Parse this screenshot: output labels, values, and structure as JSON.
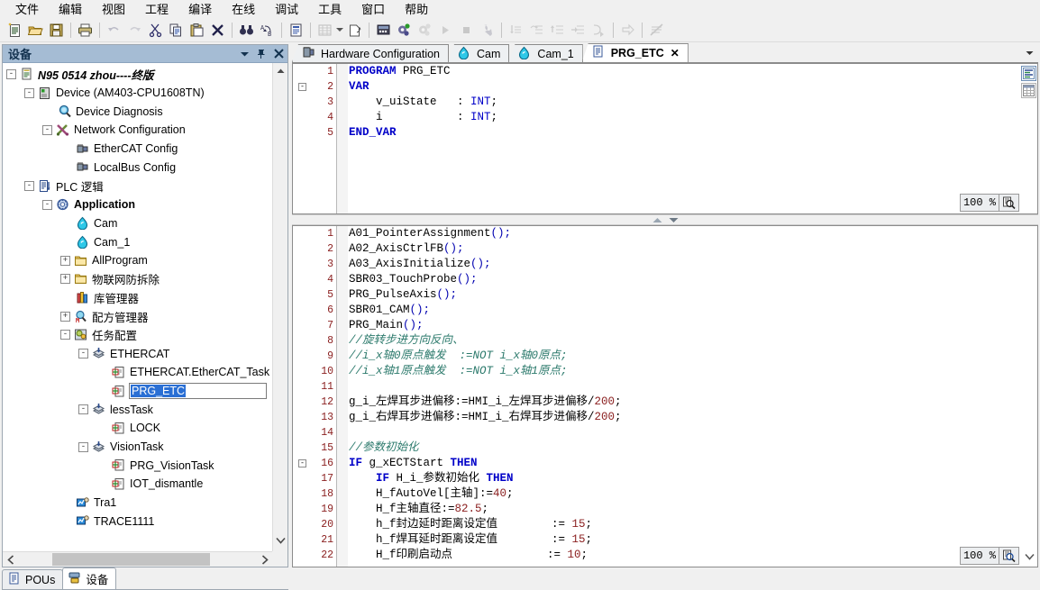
{
  "menu": {
    "items": [
      {
        "label": "文件",
        "name": "menu-file"
      },
      {
        "label": "编辑",
        "name": "menu-edit"
      },
      {
        "label": "视图",
        "name": "menu-view"
      },
      {
        "label": "工程",
        "name": "menu-project"
      },
      {
        "label": "编译",
        "name": "menu-build"
      },
      {
        "label": "在线",
        "name": "menu-online"
      },
      {
        "label": "调试",
        "name": "menu-debug"
      },
      {
        "label": "工具",
        "name": "menu-tools"
      },
      {
        "label": "窗口",
        "name": "menu-window"
      },
      {
        "label": "帮助",
        "name": "menu-help"
      }
    ]
  },
  "toolbar": {
    "buttons": [
      {
        "icon": "new-file-icon",
        "enabled": true
      },
      {
        "icon": "open-folder-icon",
        "enabled": true
      },
      {
        "icon": "save-icon",
        "enabled": true
      },
      {
        "sep": true
      },
      {
        "icon": "print-icon",
        "enabled": true
      },
      {
        "sep": true
      },
      {
        "icon": "undo-icon",
        "enabled": false
      },
      {
        "icon": "redo-icon",
        "enabled": false
      },
      {
        "icon": "cut-scissors-icon",
        "enabled": true
      },
      {
        "icon": "copy-icon",
        "enabled": true
      },
      {
        "icon": "paste-icon",
        "enabled": true
      },
      {
        "icon": "delete-x-icon",
        "enabled": true
      },
      {
        "sep": true
      },
      {
        "icon": "find-binoculars-icon",
        "enabled": true
      },
      {
        "icon": "replace-ab-icon",
        "enabled": true
      },
      {
        "sep": true
      },
      {
        "icon": "paste-clipboard-icon",
        "enabled": true
      },
      {
        "sep": true
      },
      {
        "icon": "grid-table-icon",
        "enabled": false,
        "dropdown": true
      },
      {
        "icon": "export-page-icon",
        "enabled": true
      },
      {
        "sep": true
      },
      {
        "icon": "login-plc-icon",
        "enabled": true
      },
      {
        "icon": "build-gears-green-icon",
        "enabled": true
      },
      {
        "icon": "build-gears-grey-icon",
        "enabled": false
      },
      {
        "icon": "run-play-icon",
        "enabled": false
      },
      {
        "icon": "stop-square-icon",
        "enabled": false
      },
      {
        "icon": "wrench-icon",
        "enabled": false
      },
      {
        "sep": true
      },
      {
        "icon": "step-into-icon",
        "enabled": false
      },
      {
        "icon": "step-over-icon",
        "enabled": false
      },
      {
        "icon": "step-out-icon",
        "enabled": false
      },
      {
        "icon": "run-to-cursor-icon",
        "enabled": false
      },
      {
        "icon": "set-next-statement-icon",
        "enabled": false
      },
      {
        "sep": true
      },
      {
        "icon": "next-arrow-icon",
        "enabled": false
      },
      {
        "sep": true
      },
      {
        "icon": "breakpoints-off-icon",
        "enabled": false
      }
    ]
  },
  "devices_panel": {
    "title": "设备",
    "header_buttons": [
      {
        "name": "panel-menu-dropdown-icon",
        "glyph": "▼"
      },
      {
        "name": "pin-icon",
        "glyph": "pin"
      },
      {
        "name": "close-icon",
        "glyph": "✕"
      }
    ],
    "tree": [
      {
        "indent": 0,
        "expander": "-",
        "icon": "project-doc-icon",
        "label": "N95 0514 zhou----终版",
        "style": "italic"
      },
      {
        "indent": 1,
        "expander": "-",
        "icon": "plc-device-icon",
        "label": "Device (AM403-CPU1608TN)",
        "style": "normal"
      },
      {
        "indent": 2,
        "expander": "",
        "icon": "diagnosis-magnifier-icon",
        "label": "Device Diagnosis",
        "style": "normal"
      },
      {
        "indent": 2,
        "expander": "-",
        "icon": "network-config-icon",
        "label": "Network Configuration",
        "style": "normal"
      },
      {
        "indent": 3,
        "expander": "",
        "icon": "bus-config-icon",
        "label": "EtherCAT Config",
        "style": "normal"
      },
      {
        "indent": 3,
        "expander": "",
        "icon": "bus-config-icon",
        "label": "LocalBus Config",
        "style": "normal"
      },
      {
        "indent": 1,
        "expander": "-",
        "icon": "plc-logic-icon",
        "label": "PLC 逻辑",
        "style": "normal"
      },
      {
        "indent": 2,
        "expander": "-",
        "icon": "application-icon",
        "label": "Application",
        "style": "bold"
      },
      {
        "indent": 3,
        "expander": "",
        "icon": "cam-icon",
        "label": "Cam",
        "style": "normal"
      },
      {
        "indent": 3,
        "expander": "",
        "icon": "cam-icon",
        "label": "Cam_1",
        "style": "normal"
      },
      {
        "indent": 3,
        "expander": "+",
        "icon": "folder-icon",
        "label": "AllProgram",
        "style": "normal"
      },
      {
        "indent": 3,
        "expander": "+",
        "icon": "folder-icon",
        "label": "物联网防拆除",
        "style": "normal"
      },
      {
        "indent": 3,
        "expander": "",
        "icon": "library-manager-icon",
        "label": "库管理器",
        "style": "normal"
      },
      {
        "indent": 3,
        "expander": "+",
        "icon": "recipe-manager-icon",
        "label": "配方管理器",
        "style": "normal"
      },
      {
        "indent": 3,
        "expander": "-",
        "icon": "task-config-icon",
        "label": "任务配置",
        "style": "normal"
      },
      {
        "indent": 4,
        "expander": "-",
        "icon": "task-icon",
        "label": "ETHERCAT",
        "style": "normal"
      },
      {
        "indent": 5,
        "expander": "",
        "icon": "pou-prg-icon",
        "label": "ETHERCAT.EtherCAT_Task",
        "style": "normal"
      },
      {
        "indent": 5,
        "expander": "",
        "icon": "pou-prg-icon",
        "label": "PRG_ETC",
        "style": "editing"
      },
      {
        "indent": 4,
        "expander": "-",
        "icon": "task-icon",
        "label": "lessTask",
        "style": "normal"
      },
      {
        "indent": 5,
        "expander": "",
        "icon": "pou-prg-icon",
        "label": "LOCK",
        "style": "normal"
      },
      {
        "indent": 4,
        "expander": "-",
        "icon": "task-icon",
        "label": "VisionTask",
        "style": "normal"
      },
      {
        "indent": 5,
        "expander": "",
        "icon": "pou-prg-icon",
        "label": "PRG_VisionTask",
        "style": "normal"
      },
      {
        "indent": 5,
        "expander": "",
        "icon": "pou-prg-icon",
        "label": "IOT_dismantle",
        "style": "normal"
      },
      {
        "indent": 3,
        "expander": "",
        "icon": "trace-icon",
        "label": "Tra1",
        "style": "normal"
      },
      {
        "indent": 3,
        "expander": "",
        "icon": "trace-icon",
        "label": "TRACE1111",
        "style": "clipped"
      }
    ],
    "bottom_tabs": [
      {
        "label": "POUs",
        "icon": "pou-doc-icon",
        "active": false,
        "name": "tab-pous"
      },
      {
        "label": "设备",
        "icon": "devices-icon",
        "active": true,
        "name": "tab-devices"
      }
    ]
  },
  "editor": {
    "tabs": [
      {
        "label": "Hardware Configuration",
        "icon": "hardware-config-icon",
        "active": false,
        "closable": false
      },
      {
        "label": "Cam",
        "icon": "cam-icon",
        "active": false,
        "closable": false
      },
      {
        "label": "Cam_1",
        "icon": "cam-icon",
        "active": false,
        "closable": false
      },
      {
        "label": "PRG_ETC",
        "icon": "pou-doc-icon",
        "active": true,
        "closable": true,
        "close_glyph": "✕"
      }
    ],
    "tab_overflow_glyph": "▼",
    "declaration": {
      "zoom": "100 %",
      "zoom_icon": "zoom-magnifier-icon",
      "fold_markers": [
        {
          "line": 2,
          "glyph": "-"
        }
      ],
      "lines": [
        {
          "n": 1,
          "tokens": [
            {
              "t": "PROGRAM ",
              "c": "kw"
            },
            {
              "t": "PRG_ETC",
              "c": "pl"
            }
          ]
        },
        {
          "n": 2,
          "tokens": [
            {
              "t": "VAR",
              "c": "kw"
            }
          ]
        },
        {
          "n": 3,
          "tokens": [
            {
              "t": "    v_uiState   : ",
              "c": "pl"
            },
            {
              "t": "INT",
              "c": "kwb"
            },
            {
              "t": ";",
              "c": "pl"
            }
          ]
        },
        {
          "n": 4,
          "tokens": [
            {
              "t": "    i           : ",
              "c": "pl"
            },
            {
              "t": "INT",
              "c": "kwb"
            },
            {
              "t": ";",
              "c": "pl"
            }
          ]
        },
        {
          "n": 5,
          "tokens": [
            {
              "t": "END_VAR",
              "c": "kw"
            }
          ]
        }
      ]
    },
    "implementation": {
      "zoom": "100 %",
      "zoom_icon": "zoom-magnifier-icon",
      "fold_markers": [
        {
          "line": 16,
          "glyph": "-"
        }
      ],
      "lines": [
        {
          "n": 1,
          "tokens": [
            {
              "t": "A01_PointerAssignment",
              "c": "pl"
            },
            {
              "t": "();",
              "c": "pun"
            }
          ]
        },
        {
          "n": 2,
          "tokens": [
            {
              "t": "A02_AxisCtrlFB",
              "c": "pl"
            },
            {
              "t": "();",
              "c": "pun"
            }
          ]
        },
        {
          "n": 3,
          "tokens": [
            {
              "t": "A03_AxisInitialize",
              "c": "pl"
            },
            {
              "t": "();",
              "c": "pun"
            }
          ]
        },
        {
          "n": 4,
          "tokens": [
            {
              "t": "SBR03_TouchProbe",
              "c": "pl"
            },
            {
              "t": "();",
              "c": "pun"
            }
          ]
        },
        {
          "n": 5,
          "tokens": [
            {
              "t": "PRG_PulseAxis",
              "c": "pl"
            },
            {
              "t": "();",
              "c": "pun"
            }
          ]
        },
        {
          "n": 6,
          "tokens": [
            {
              "t": "SBR01_CAM",
              "c": "pl"
            },
            {
              "t": "();",
              "c": "pun"
            }
          ]
        },
        {
          "n": 7,
          "tokens": [
            {
              "t": "PRG_Main",
              "c": "pl"
            },
            {
              "t": "();",
              "c": "pun"
            }
          ]
        },
        {
          "n": 8,
          "tokens": [
            {
              "t": "//旋转步进方向反向、",
              "c": "cm"
            }
          ]
        },
        {
          "n": 9,
          "tokens": [
            {
              "t": "//i_x轴0原点触发  :=NOT i_x轴0原点;",
              "c": "cm"
            }
          ]
        },
        {
          "n": 10,
          "tokens": [
            {
              "t": "//i_x轴1原点触发  :=NOT i_x轴1原点;",
              "c": "cm"
            }
          ]
        },
        {
          "n": 11,
          "tokens": [
            {
              "t": "",
              "c": "pl"
            }
          ]
        },
        {
          "n": 12,
          "tokens": [
            {
              "t": "g_i_左焊耳步进偏移:=HMI_i_左焊耳步进偏移/",
              "c": "pl"
            },
            {
              "t": "200",
              "c": "num"
            },
            {
              "t": ";",
              "c": "pl"
            }
          ]
        },
        {
          "n": 13,
          "tokens": [
            {
              "t": "g_i_右焊耳步进偏移:=HMI_i_右焊耳步进偏移/",
              "c": "pl"
            },
            {
              "t": "200",
              "c": "num"
            },
            {
              "t": ";",
              "c": "pl"
            }
          ]
        },
        {
          "n": 14,
          "tokens": [
            {
              "t": "",
              "c": "pl"
            }
          ]
        },
        {
          "n": 15,
          "tokens": [
            {
              "t": "//参数初始化",
              "c": "cm"
            }
          ]
        },
        {
          "n": 16,
          "tokens": [
            {
              "t": "IF ",
              "c": "kw"
            },
            {
              "t": "g_xECTStart ",
              "c": "pl"
            },
            {
              "t": "THEN",
              "c": "kw"
            }
          ]
        },
        {
          "n": 17,
          "tokens": [
            {
              "t": "    ",
              "c": "pl"
            },
            {
              "t": "IF ",
              "c": "kw"
            },
            {
              "t": "H_i_参数初始化 ",
              "c": "pl"
            },
            {
              "t": "THEN",
              "c": "kw"
            }
          ]
        },
        {
          "n": 18,
          "tokens": [
            {
              "t": "    H_fAutoVel[主轴]:=",
              "c": "pl"
            },
            {
              "t": "40",
              "c": "num"
            },
            {
              "t": ";",
              "c": "pl"
            }
          ]
        },
        {
          "n": 19,
          "tokens": [
            {
              "t": "    H_f主轴直径:=",
              "c": "pl"
            },
            {
              "t": "82.5",
              "c": "num"
            },
            {
              "t": ";",
              "c": "pl"
            }
          ]
        },
        {
          "n": 20,
          "tokens": [
            {
              "t": "    h_f封边延时距离设定值        := ",
              "c": "pl"
            },
            {
              "t": "15",
              "c": "num"
            },
            {
              "t": ";",
              "c": "pl"
            }
          ]
        },
        {
          "n": 21,
          "tokens": [
            {
              "t": "    h_f焊耳延时距离设定值        := ",
              "c": "pl"
            },
            {
              "t": "15",
              "c": "num"
            },
            {
              "t": ";",
              "c": "pl"
            }
          ]
        },
        {
          "n": 22,
          "tokens": [
            {
              "t": "    H_f印刷启动点              := ",
              "c": "pl"
            },
            {
              "t": "10",
              "c": "num"
            },
            {
              "t": ";",
              "c": "pl"
            }
          ]
        }
      ]
    },
    "side_buttons": [
      {
        "name": "declaration-view-icon"
      },
      {
        "name": "table-view-icon"
      }
    ]
  },
  "colors": {
    "panel_header": "#a5bcd4",
    "keyword": "#0000c8",
    "comment": "#2c7a6c",
    "number": "#8b2020",
    "selection": "#2a6fd4"
  }
}
